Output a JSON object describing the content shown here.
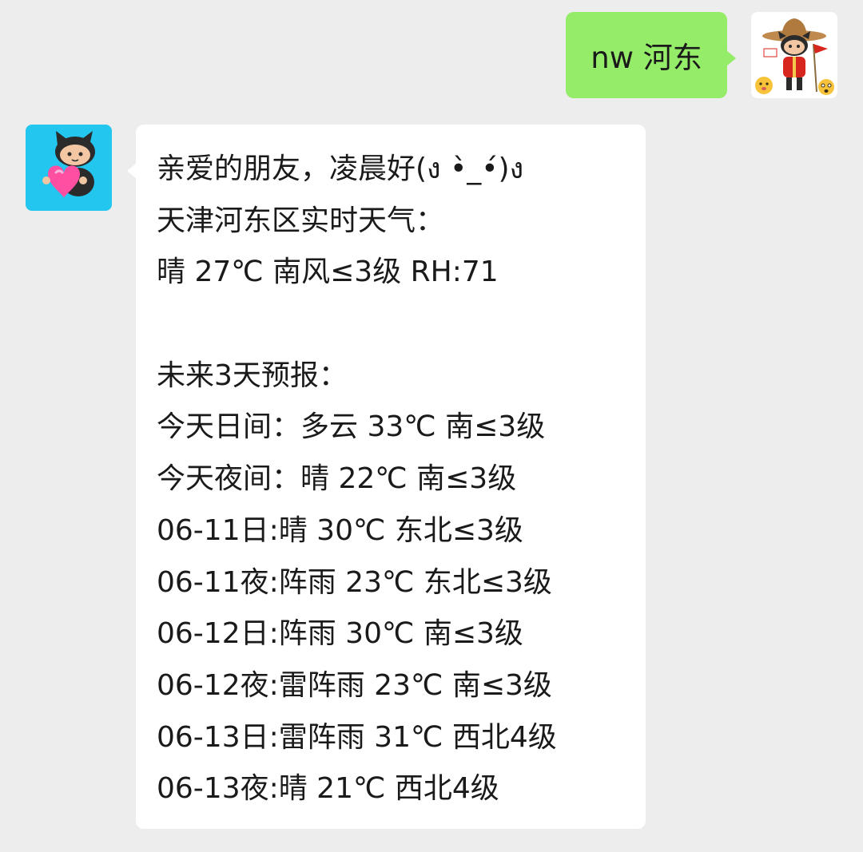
{
  "chat": {
    "outgoing": {
      "text": "nw 河东",
      "avatar_icon": "red-uniform-octocat-avatar-icon"
    },
    "incoming": {
      "avatar_icon": "octocat-heart-avatar-icon",
      "lines": [
        "亲爱的朋友，凌晨好(ง •̀_•́)ง",
        "天津河东区实时天气：",
        "晴 27℃ 南风≤3级 RH:71",
        "",
        "未来3天预报：",
        "今天日间：多云 33℃ 南≤3级",
        "今天夜间：晴 22℃ 南≤3级",
        "06-11日:晴 30℃ 东北≤3级",
        "06-11夜:阵雨 23℃ 东北≤3级",
        "06-12日:阵雨 30℃ 南≤3级",
        "06-12夜:雷阵雨 23℃ 南≤3级",
        "06-13日:雷阵雨 31℃ 西北4级",
        "06-13夜:晴 21℃ 西北4级"
      ]
    }
  },
  "colors": {
    "background": "#ededed",
    "outgoing_bubble": "#95ec69",
    "incoming_bubble": "#ffffff",
    "bot_avatar_bg": "#22c6ee"
  }
}
